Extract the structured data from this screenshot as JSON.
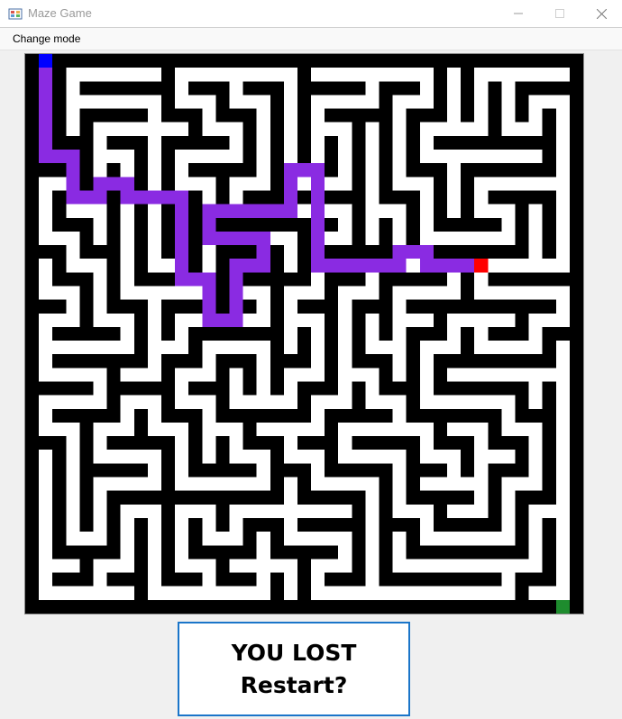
{
  "window": {
    "title": "Maze Game",
    "controls": {
      "minimize": "—",
      "maximize": "☐",
      "close": "✕"
    }
  },
  "menu": {
    "items": [
      {
        "label": "Change mode"
      }
    ]
  },
  "maze": {
    "grid_size": 41,
    "colors": {
      "wall": "#000000",
      "floor": "#ffffff",
      "path": "#8a2be2",
      "start": "#0000ff",
      "player": "#ff0000",
      "goal": "#1e8c2e"
    },
    "start_cell": [
      1,
      0
    ],
    "goal_cell": [
      39,
      40
    ],
    "player_cell": [
      33,
      15
    ],
    "path": [
      [
        1,
        0
      ],
      [
        1,
        1
      ],
      [
        1,
        2
      ],
      [
        1,
        3
      ],
      [
        1,
        4
      ],
      [
        1,
        5
      ],
      [
        1,
        6
      ],
      [
        1,
        7
      ],
      [
        2,
        7
      ],
      [
        3,
        7
      ],
      [
        3,
        8
      ],
      [
        3,
        9
      ],
      [
        3,
        10
      ],
      [
        4,
        10
      ],
      [
        5,
        10
      ],
      [
        5,
        9
      ],
      [
        6,
        9
      ],
      [
        7,
        9
      ],
      [
        7,
        10
      ],
      [
        8,
        10
      ],
      [
        9,
        10
      ],
      [
        10,
        10
      ],
      [
        11,
        10
      ],
      [
        11,
        11
      ],
      [
        11,
        12
      ],
      [
        11,
        13
      ],
      [
        11,
        14
      ],
      [
        11,
        15
      ],
      [
        11,
        16
      ],
      [
        12,
        16
      ],
      [
        13,
        16
      ],
      [
        13,
        17
      ],
      [
        13,
        18
      ],
      [
        13,
        19
      ],
      [
        14,
        19
      ],
      [
        15,
        19
      ],
      [
        15,
        18
      ],
      [
        15,
        17
      ],
      [
        15,
        16
      ],
      [
        15,
        15
      ],
      [
        16,
        15
      ],
      [
        17,
        15
      ],
      [
        17,
        14
      ],
      [
        17,
        13
      ],
      [
        16,
        13
      ],
      [
        15,
        13
      ],
      [
        14,
        13
      ],
      [
        13,
        13
      ],
      [
        13,
        12
      ],
      [
        13,
        11
      ],
      [
        14,
        11
      ],
      [
        15,
        11
      ],
      [
        16,
        11
      ],
      [
        17,
        11
      ],
      [
        18,
        11
      ],
      [
        19,
        11
      ],
      [
        19,
        10
      ],
      [
        19,
        9
      ],
      [
        19,
        8
      ],
      [
        20,
        8
      ],
      [
        21,
        8
      ],
      [
        21,
        9
      ],
      [
        21,
        10
      ],
      [
        21,
        11
      ],
      [
        21,
        12
      ],
      [
        21,
        13
      ],
      [
        21,
        14
      ],
      [
        21,
        15
      ],
      [
        22,
        15
      ],
      [
        23,
        15
      ],
      [
        24,
        15
      ],
      [
        25,
        15
      ],
      [
        26,
        15
      ],
      [
        27,
        15
      ],
      [
        27,
        14
      ],
      [
        28,
        14
      ],
      [
        29,
        14
      ],
      [
        29,
        15
      ],
      [
        30,
        15
      ],
      [
        31,
        15
      ],
      [
        32,
        15
      ],
      [
        33,
        15
      ]
    ]
  },
  "restart": {
    "line1": "YOU LOST",
    "line2": "Restart?"
  }
}
